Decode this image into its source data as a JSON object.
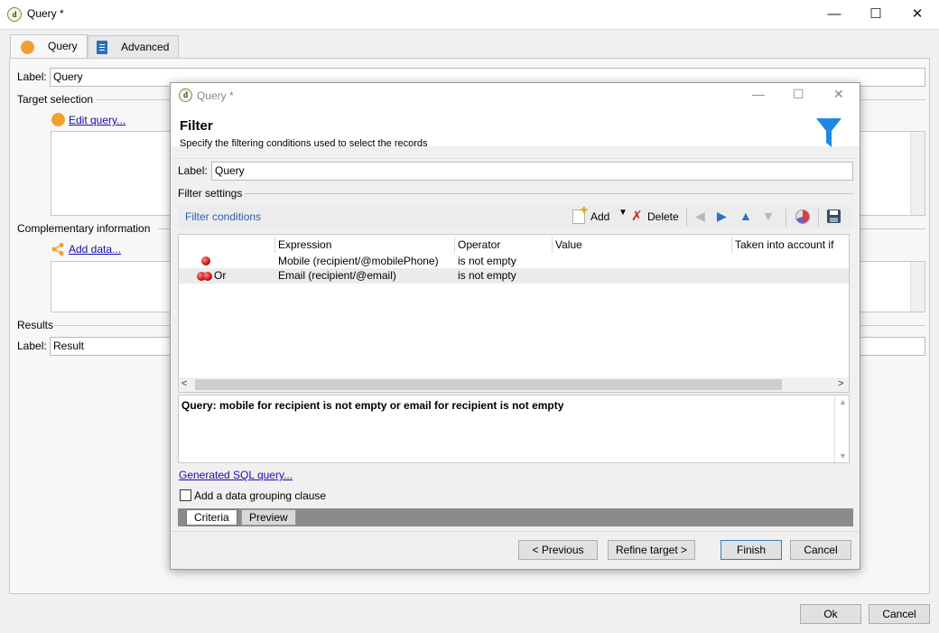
{
  "window": {
    "title": "Query *",
    "minimize": "—",
    "maximize": "☐",
    "close": "✕",
    "app_icon": "d"
  },
  "tabs": [
    {
      "label": "Query",
      "icon": "orange-circle-icon"
    },
    {
      "label": "Advanced",
      "icon": "clipboard-icon"
    }
  ],
  "main": {
    "label_caption": "Label:",
    "label_value": "Query",
    "target_section": "Target selection",
    "edit_query_link": "Edit query...",
    "complementary_section": "Complementary information",
    "add_data_link": "Add data...",
    "results_section": "Results",
    "result_label_caption": "Label:",
    "result_label_value": "Result"
  },
  "footer": {
    "ok": "Ok",
    "cancel": "Cancel"
  },
  "dialog": {
    "title": "Query *",
    "heading": "Filter",
    "subheading": "Specify the filtering conditions used to select the records",
    "label_caption": "Label:",
    "label_value": "Query",
    "filter_settings": "Filter settings",
    "filter_conditions": "Filter conditions",
    "toolbar": {
      "add": "Add",
      "delete": "Delete"
    },
    "columns": [
      "Expression",
      "Operator",
      "Value",
      "Taken into account if"
    ],
    "rows": [
      {
        "prefix": "",
        "expression": "Mobile (recipient/@mobilePhone)",
        "operator": "is not empty",
        "value": ""
      },
      {
        "prefix": "Or",
        "expression": "Email (recipient/@email)",
        "operator": "is not empty",
        "value": ""
      }
    ],
    "query_summary": "Query: mobile for recipient is not empty or email for recipient is not empty",
    "sql_link": "Generated SQL query...",
    "grouping_checkbox": "Add a data grouping clause",
    "subtabs": [
      "Criteria",
      "Preview"
    ],
    "buttons": {
      "previous": "< Previous",
      "refine": "Refine target >",
      "finish": "Finish",
      "cancel": "Cancel"
    }
  },
  "colors": {
    "accent_orange": "#f0a030",
    "link_blue": "#1a0dab",
    "funnel_blue": "#1e88e5",
    "header_blue": "#2b5fb5"
  }
}
